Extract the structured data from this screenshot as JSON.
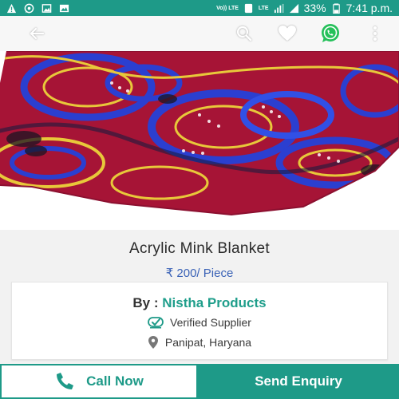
{
  "status_bar": {
    "left_icons": [
      "warning-icon",
      "whatsapp-notification-icon",
      "image-notification-icon",
      "gallery-notification-icon"
    ],
    "volte_label": "Vo)) LTE",
    "sim_label": "1",
    "lte_label": "LTE",
    "battery": "33%",
    "time": "7:41 p.m."
  },
  "app_bar": {
    "icons": [
      "back-arrow-icon",
      "search-icon",
      "heart-icon",
      "whatsapp-icon",
      "more-vert-icon"
    ]
  },
  "product": {
    "title": "Acrylic Mink Blanket",
    "price": "₹ 200/ Piece"
  },
  "supplier": {
    "by_label": "By :",
    "name": "Nistha Products",
    "verified_label": "Verified Supplier",
    "location": "Panipat, Haryana"
  },
  "actions": {
    "call_label": "Call Now",
    "enquiry_label": "Send Enquiry"
  },
  "colors": {
    "primary": "#1e9a88",
    "price": "#3a62b6",
    "blanket_red": "#b5163a",
    "blanket_blue": "#2b3fd0"
  }
}
